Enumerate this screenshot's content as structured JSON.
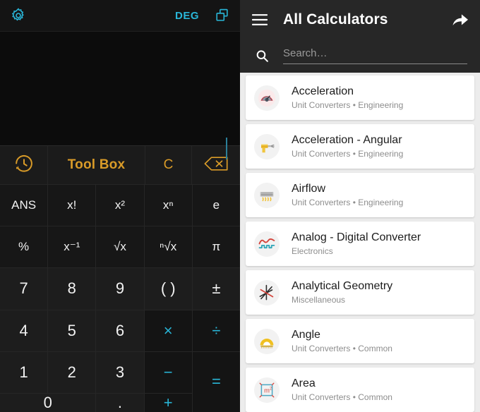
{
  "calculator": {
    "topbar": {
      "settings_icon": "gear-icon",
      "angle_mode": "DEG",
      "windows_icon": "copy-windows-icon"
    },
    "display": {
      "expression": "",
      "cursor_visible": true
    },
    "toolbar": {
      "history_icon": "history-clock-icon",
      "tool_box_label": "Tool Box",
      "clear_label": "C",
      "backspace_icon": "backspace-icon",
      "accent_color": "#d99b28"
    },
    "keys": [
      {
        "label": "ANS",
        "kind": "fn",
        "name": "key-ans"
      },
      {
        "label": "x!",
        "kind": "fn",
        "name": "key-factorial"
      },
      {
        "label": "x²",
        "kind": "fn",
        "name": "key-square"
      },
      {
        "label": "xⁿ",
        "kind": "fn",
        "name": "key-power-n"
      },
      {
        "label": "e",
        "kind": "fn",
        "name": "key-e"
      },
      {
        "label": "%",
        "kind": "fn",
        "name": "key-percent"
      },
      {
        "label": "x⁻¹",
        "kind": "fn",
        "name": "key-reciprocal"
      },
      {
        "label": "√x",
        "kind": "fn",
        "name": "key-sqrt"
      },
      {
        "label": "ⁿ√x",
        "kind": "fn",
        "name": "key-nth-root"
      },
      {
        "label": "π",
        "kind": "fn",
        "name": "key-pi"
      },
      {
        "label": "7",
        "kind": "num",
        "name": "key-7"
      },
      {
        "label": "8",
        "kind": "num",
        "name": "key-8"
      },
      {
        "label": "9",
        "kind": "num",
        "name": "key-9"
      },
      {
        "label": "( )",
        "kind": "num",
        "name": "key-parentheses"
      },
      {
        "label": "±",
        "kind": "num",
        "name": "key-plus-minus"
      },
      {
        "label": "4",
        "kind": "num",
        "name": "key-4"
      },
      {
        "label": "5",
        "kind": "num",
        "name": "key-5"
      },
      {
        "label": "6",
        "kind": "num",
        "name": "key-6"
      },
      {
        "label": "×",
        "kind": "op",
        "name": "key-multiply"
      },
      {
        "label": "÷",
        "kind": "op",
        "name": "key-divide"
      },
      {
        "label": "1",
        "kind": "num",
        "name": "key-1"
      },
      {
        "label": "2",
        "kind": "num",
        "name": "key-2"
      },
      {
        "label": "3",
        "kind": "num",
        "name": "key-3"
      },
      {
        "label": "−",
        "kind": "op",
        "name": "key-minus"
      },
      {
        "label": "=",
        "kind": "eq",
        "name": "key-equals"
      },
      {
        "label": "0",
        "kind": "zero",
        "name": "key-0"
      },
      {
        "label": ".",
        "kind": "num",
        "name": "key-decimal"
      },
      {
        "label": "+",
        "kind": "op",
        "name": "key-plus"
      }
    ],
    "op_color": "#29b6d8"
  },
  "list_pane": {
    "header": {
      "menu_icon": "hamburger-menu-icon",
      "title": "All Calculators",
      "share_icon": "share-icon"
    },
    "search": {
      "icon": "search-icon",
      "value": "",
      "placeholder": "Search…"
    },
    "items": [
      {
        "title": "Acceleration",
        "subtitle": "Unit Converters • Engineering",
        "icon": "gauge-icon"
      },
      {
        "title": "Acceleration - Angular",
        "subtitle": "Unit Converters • Engineering",
        "icon": "drill-icon"
      },
      {
        "title": "Airflow",
        "subtitle": "Unit Converters • Engineering",
        "icon": "air-conditioner-icon"
      },
      {
        "title": "Analog - Digital Converter",
        "subtitle": "Electronics",
        "icon": "waveform-icon"
      },
      {
        "title": "Analytical Geometry",
        "subtitle": "Miscellaneous",
        "icon": "axes-line-icon"
      },
      {
        "title": "Angle",
        "subtitle": "Unit Converters • Common",
        "icon": "protractor-icon"
      },
      {
        "title": "Area",
        "subtitle": "Unit Converters • Common",
        "icon": "area-ruler-icon"
      }
    ]
  }
}
